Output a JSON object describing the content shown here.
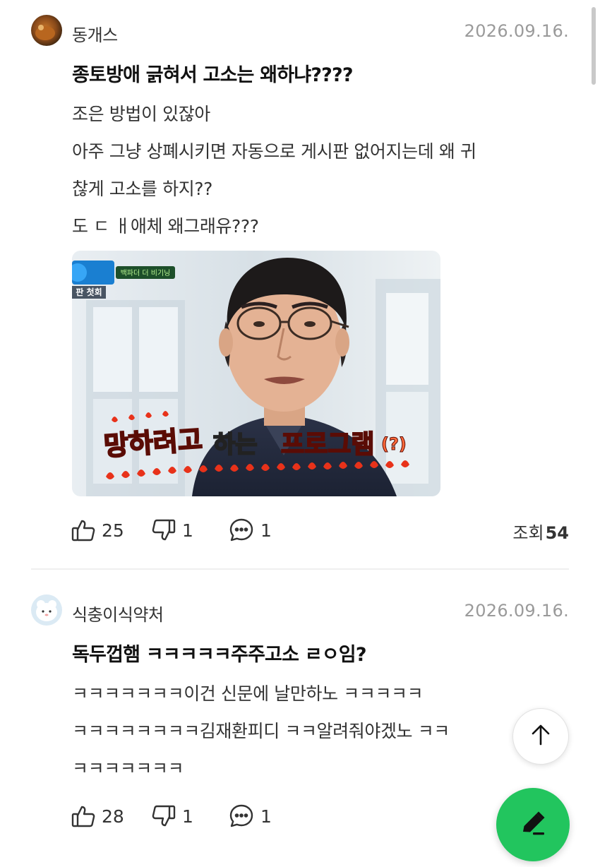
{
  "posts": [
    {
      "author": "동개스",
      "date": "2026.09.16.",
      "title": "종토방애 긁혀서 고소는 왜하냐????",
      "lines": [
        "조은 방법이 있잖아",
        "아주 그냥 상폐시키면 자동으로 게시판 없어지는데 왜 귀",
        "찮게 고소를 하지??",
        "도 ㄷ ㅐ애체 왜그래유???"
      ],
      "image": {
        "badge": "백파더 더 비기닝",
        "corner": "판 첫회",
        "caption_red1": "망하려고",
        "caption_white": "하는",
        "caption_red2": "프로그램",
        "caption_q": "(?)"
      },
      "likes": "25",
      "dislikes": "1",
      "comments": "1",
      "views_label": "조회",
      "views": "54"
    },
    {
      "author": "식충이식약처",
      "date": "2026.09.16.",
      "title": "독두껍햄 ㅋㅋㅋㅋㅋ주주고소 ㄹㅇ임?",
      "lines": [
        "ㅋㅋㅋㅋㅋㅋㅋ이건 신문에 날만하노 ㅋㅋㅋㅋㅋ",
        "ㅋㅋㅋㅋㅋㅋㅋㅋ김재환피디 ㅋㅋ알려줘야겠노 ㅋㅋ",
        "ㅋㅋㅋㅋㅋㅋㅋ"
      ],
      "likes": "28",
      "dislikes": "1",
      "comments": "1"
    }
  ],
  "icons": {
    "like": "thumbs-up-icon",
    "dislike": "thumbs-down-icon",
    "comment": "speech-bubble-icon",
    "scroll_top": "arrow-up-icon",
    "write": "pencil-icon"
  },
  "colors": {
    "accent_green": "#22c55e",
    "meta_gray": "#9a9a9a",
    "caption_red": "#e8321a"
  }
}
